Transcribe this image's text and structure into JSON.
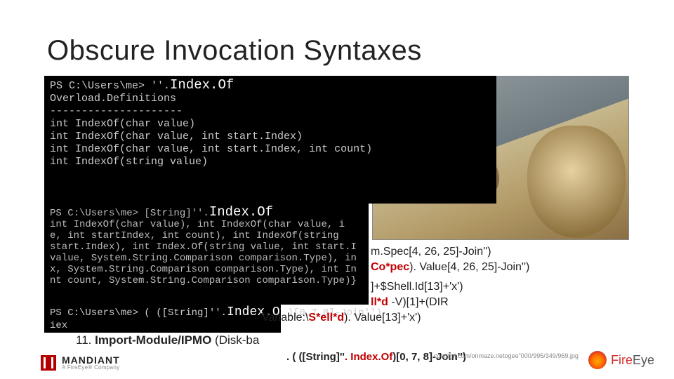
{
  "title": "Obscure Invocation Syntaxes",
  "terminal1": {
    "prompt_line": "PS C:\\Users\\me> ''.",
    "prompt_highlight": "Index.Of",
    "body": "\nOverload.Definitions\n---------------------\nint IndexOf(char value)\nint IndexOf(char value, int start.Index)\nint IndexOf(char value, int start.Index, int count)\nint IndexOf(string value)"
  },
  "terminal2": {
    "prompt_line": "PS C:\\Users\\me> [String]''.",
    "prompt_highlight": "Index.Of",
    "body": "int IndexOf(char value), int IndexOf(char value, i\ne, int startIndex, int count), int IndexOf(string\nstart.Index), int Index.Of(string value, int start.I\nvalue, System.String.Comparison comparison.Type), in\nx, System.String.Comparison comparison.Type), int In\nnt count, System.String.Comparison comparison.Type)}"
  },
  "terminal3": {
    "prompt_line": "PS C:\\Users\\me> ( ([String]''.",
    "prompt_highlight": "Index.Of",
    "prompt_after": ")[0,7,8]-Join'')",
    "out": "iex"
  },
  "behind_text": {
    "l1_a": "m.Spec[4, 26, 25]-Join'')",
    "l2_a": "Co*pec",
    "l2_b": "). Value[4, 26, 25]-Join'')",
    "l3_a": "]+$Shell.Id[13]+'x')",
    "l4_a": "ll*d",
    "l4_b": " -V)[1]+(DIR",
    "l5_a": "Variable:\\",
    "l5_b": "S*ell*d",
    "l5_c": "). Value[13]+'x')"
  },
  "bullet11": {
    "num": "11.",
    "bold": "Import-Module/IPMO",
    "rest": " (Disk-ba"
  },
  "callout": {
    "prefix": ". ( ([String]''",
    "red": ". Index.Of",
    "suffix": ")[0, 7, 8]-Join'')"
  },
  "photo_alt": "Photograph of two pugs",
  "tiny_url": "cdn.bmj.com/onmaze.netogee\"000/995/349/969.jpg",
  "logos": {
    "mandiant": "MANDIANT",
    "mandiant_sub": "A FireEye® Company",
    "fire": "Fire",
    "eye": "Eye"
  }
}
